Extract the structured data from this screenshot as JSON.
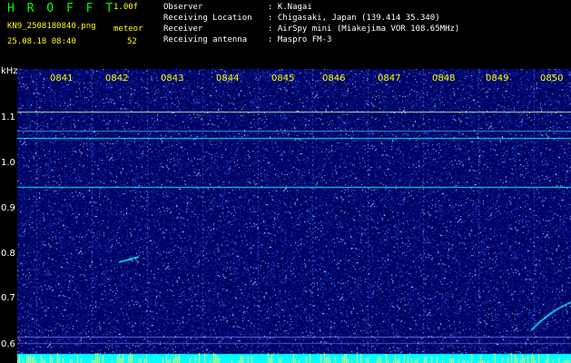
{
  "app": {
    "title": "H R O F F T",
    "version": "1.00f",
    "filename": "KN9_2508180840.png",
    "mode": "meteor",
    "count": "52",
    "datetime": "25.08.18 08:40"
  },
  "info": [
    {
      "label": "Observer",
      "value": ": K.Nagai"
    },
    {
      "label": "Receiving Location",
      "value": ": Chigasaki, Japan (139.414 35.340)"
    },
    {
      "label": "Receiver",
      "value": ": AirSpy mini (Miakejima VOR 108.65MHz)"
    },
    {
      "label": "Receiving antenna",
      "value": ": Maspro FM-3"
    }
  ],
  "axis": {
    "unit": "kHz",
    "y_labels": [
      "1.1",
      "1.0",
      "0.9",
      "0.8",
      "0.7",
      "0.6"
    ],
    "time_labels": [
      "0841",
      "0842",
      "0843",
      "0844",
      "0845",
      "0846",
      "0847",
      "0848",
      "0849",
      "0850"
    ]
  },
  "colors": {
    "background": "#00005a",
    "signal": "#00ffff",
    "accent_green": "#00ff00",
    "accent_yellow": "#ffff00"
  }
}
